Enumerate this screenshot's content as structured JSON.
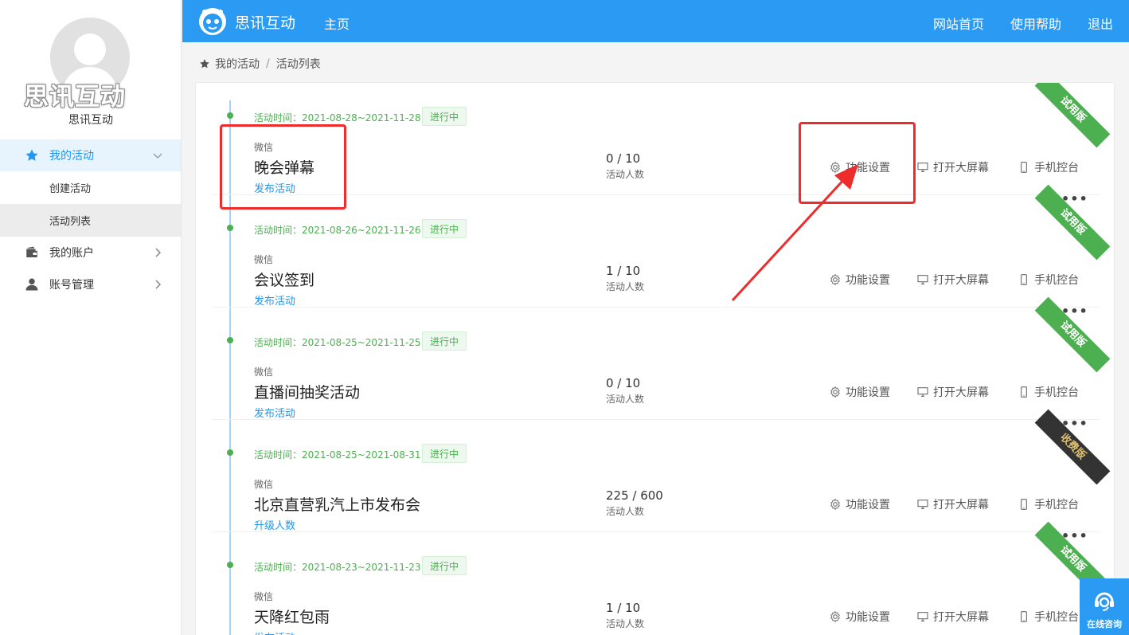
{
  "sidebar": {
    "watermark": "思讯互动",
    "username": "思讯互动",
    "menu": {
      "my_activities": "我的活动",
      "create_activity": "创建活动",
      "activity_list": "活动列表",
      "my_account": "我的账户",
      "account_manage": "账号管理"
    }
  },
  "header": {
    "brand": "思讯互动",
    "home": "主页",
    "site_home": "网站首页",
    "help": "使用帮助",
    "logout": "退出"
  },
  "breadcrumb": {
    "root": "我的活动",
    "separator": "/",
    "current": "活动列表"
  },
  "ops": {
    "settings": "功能设置",
    "big_screen": "打开大屏幕",
    "mobile": "手机控台",
    "more": "•••"
  },
  "activities": [
    {
      "time": "活动时间：2021-08-28~2021-11-28",
      "status": "进行中",
      "platform": "微信",
      "title": "晚会弹幕",
      "link": "发布活动",
      "count": "0 / 10",
      "count_label": "活动人数",
      "ribbon": "试用版"
    },
    {
      "time": "活动时间：2021-08-26~2021-11-26",
      "status": "进行中",
      "platform": "微信",
      "title": "会议签到",
      "link": "发布活动",
      "count": "1 / 10",
      "count_label": "活动人数",
      "ribbon": "试用版"
    },
    {
      "time": "活动时间：2021-08-25~2021-11-25",
      "status": "进行中",
      "platform": "微信",
      "title": "直播间抽奖活动",
      "link": "发布活动",
      "count": "0 / 10",
      "count_label": "活动人数",
      "ribbon": "试用版"
    },
    {
      "time": "活动时间：2021-08-25~2021-08-31",
      "status": "进行中",
      "platform": "微信",
      "title": "北京直营乳汽上市发布会",
      "link": "升级人数",
      "count": "225 / 600",
      "count_label": "活动人数",
      "ribbon": "收费版"
    },
    {
      "time": "活动时间：2021-08-23~2021-11-23",
      "status": "进行中",
      "platform": "微信",
      "title": "天降红包雨",
      "link": "发布活动",
      "count": "1 / 10",
      "count_label": "活动人数",
      "ribbon": "试用版"
    }
  ],
  "consult": "在线咨询",
  "colors": {
    "primary": "#2b9af3",
    "success": "#4caf50",
    "annotation": "#ee2c2c"
  }
}
